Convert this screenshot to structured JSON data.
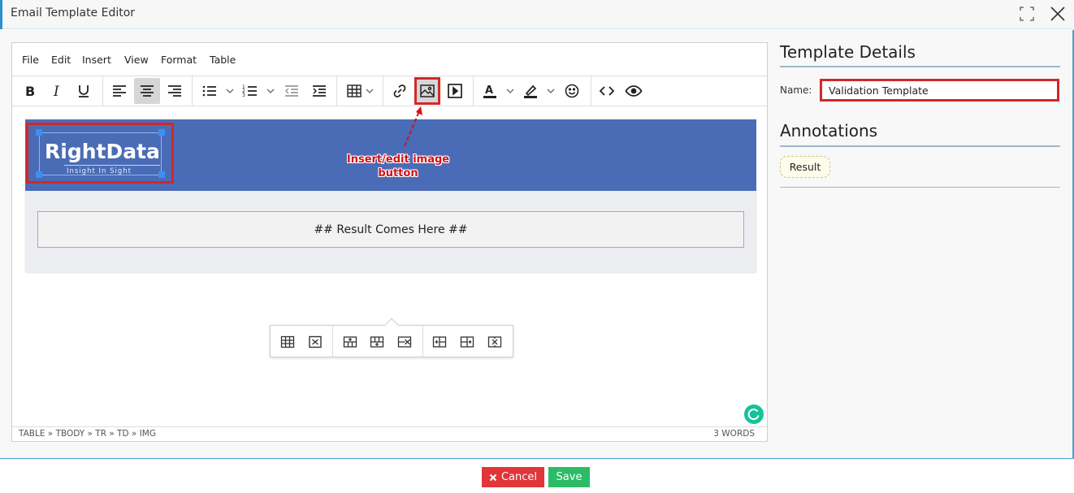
{
  "window": {
    "title": "Email Template Editor",
    "maximize_icon": "maximize-icon",
    "close_icon": "close-icon"
  },
  "menu": [
    "File",
    "Edit",
    "Insert",
    "View",
    "Format",
    "Table"
  ],
  "toolbar": {
    "buttons": [
      "bold",
      "italic",
      "underline",
      "align-left",
      "align-center",
      "align-right",
      "bullet-list",
      "numbered-list",
      "outdent",
      "indent",
      "table",
      "link",
      "image",
      "media",
      "text-color",
      "highlight",
      "emoji",
      "source-code",
      "preview"
    ],
    "active": "align-center"
  },
  "content": {
    "logo_title": "RightData",
    "logo_tagline": "Insight In Sight",
    "result_placeholder": "## Result Comes Here ##",
    "banner_color": "#4a6cb6"
  },
  "annotation": {
    "label": "Insert/edit image button"
  },
  "statusbar": {
    "path": "TABLE » TBODY » TR » TD » IMG",
    "word_count": "3 WORDS"
  },
  "details": {
    "heading": "Template Details",
    "name_label": "Name:",
    "name_value": "Validation Template",
    "annotations_heading": "Annotations",
    "annotations": [
      "Result"
    ]
  },
  "footer": {
    "cancel_label": "Cancel",
    "save_label": "Save",
    "cancel_color": "#e0353a",
    "save_color": "#2cbc67"
  }
}
